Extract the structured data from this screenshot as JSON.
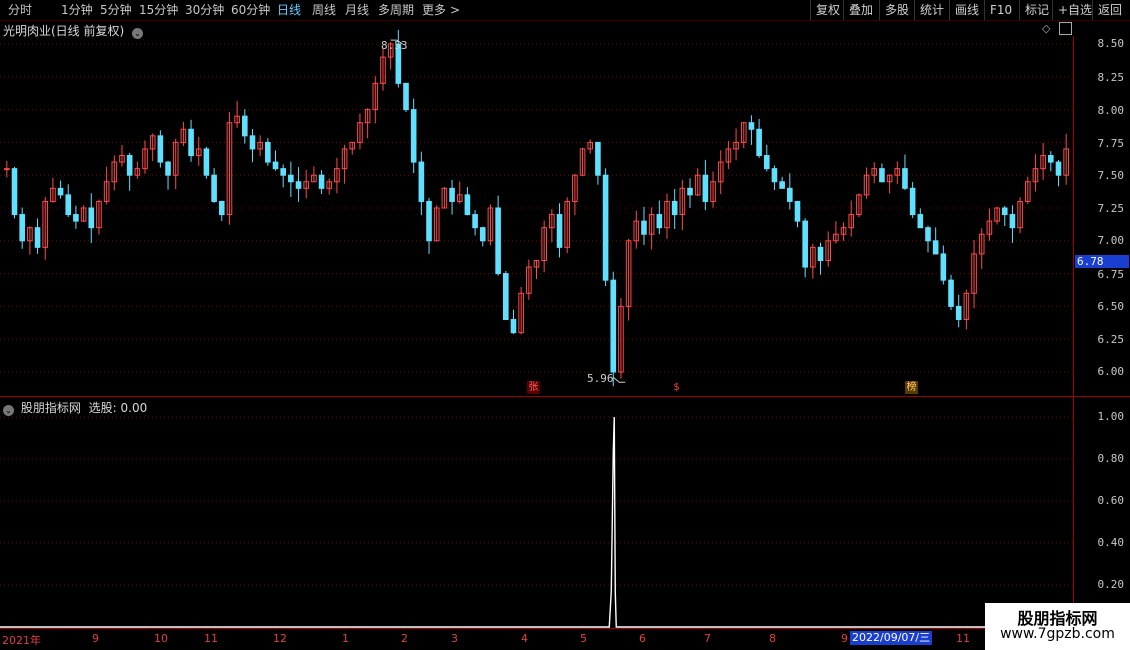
{
  "toolbar": {
    "periods": [
      "分时",
      "1分钟",
      "5分钟",
      "15分钟",
      "30分钟",
      "60分钟",
      "日线",
      "周线",
      "月线",
      "多周期",
      "更多"
    ],
    "active_period": "日线",
    "more_arrow": ">",
    "actions": [
      "复权",
      "叠加",
      "多股",
      "统计",
      "画线",
      "F10",
      "标记",
      "+自选",
      "返回"
    ]
  },
  "main_panel": {
    "title": "光明肉业(日线 前复权)",
    "y_ticks": [
      "8.50",
      "8.25",
      "8.00",
      "7.75",
      "7.50",
      "7.25",
      "7.00",
      "6.75",
      "6.50",
      "6.25",
      "6.00"
    ],
    "current_price": "6.78",
    "high_label": "8.53",
    "low_label": "5.96",
    "badges": [
      {
        "text": "张",
        "color": "#ff6060",
        "bg": "#5a0000"
      },
      {
        "text": "$",
        "color": "#ff4040",
        "bg": "#000000"
      },
      {
        "text": "榜",
        "color": "#ffcc66",
        "bg": "#5a3a00"
      }
    ]
  },
  "indicator_panel": {
    "title": "股朋指标网",
    "signal_label": "选股: 0.00",
    "y_ticks": [
      "1.00",
      "0.80",
      "0.60",
      "0.40",
      "0.20"
    ]
  },
  "x_axis": {
    "labels": [
      "2021年",
      "9",
      "10",
      "11",
      "12",
      "1",
      "2",
      "3",
      "4",
      "5",
      "6",
      "7",
      "8",
      "9",
      "11"
    ],
    "cursor_date": "2022/09/07/三"
  },
  "watermark": {
    "line1": "股朋指标网",
    "line2": "www.7gpzb.com"
  },
  "colors": {
    "up": "#ff4a4a",
    "down": "#5fe0ff",
    "grid": "#7a0000",
    "accent": "#1a3fd0"
  },
  "chart_data": {
    "type": "candlestick",
    "price_range": [
      5.96,
      8.53
    ],
    "ylim": [
      5.9,
      8.6
    ],
    "closes": [
      7.55,
      7.2,
      7.0,
      7.1,
      6.95,
      7.3,
      7.4,
      7.35,
      7.2,
      7.15,
      7.25,
      7.1,
      7.3,
      7.45,
      7.6,
      7.65,
      7.5,
      7.55,
      7.7,
      7.8,
      7.6,
      7.5,
      7.75,
      7.85,
      7.65,
      7.7,
      7.5,
      7.3,
      7.2,
      7.9,
      7.95,
      7.8,
      7.7,
      7.75,
      7.6,
      7.55,
      7.5,
      7.45,
      7.4,
      7.45,
      7.5,
      7.4,
      7.45,
      7.55,
      7.7,
      7.75,
      7.9,
      8.0,
      8.2,
      8.4,
      8.5,
      8.2,
      8.0,
      7.6,
      7.3,
      7.0,
      7.25,
      7.4,
      7.3,
      7.35,
      7.2,
      7.1,
      7.0,
      7.25,
      6.75,
      6.4,
      6.3,
      6.6,
      6.8,
      6.85,
      7.1,
      7.2,
      6.95,
      7.3,
      7.5,
      7.7,
      7.75,
      7.5,
      6.7,
      6.0,
      6.5,
      7.0,
      7.15,
      7.05,
      7.2,
      7.1,
      7.3,
      7.2,
      7.4,
      7.35,
      7.5,
      7.3,
      7.45,
      7.6,
      7.7,
      7.75,
      7.9,
      7.85,
      7.65,
      7.55,
      7.45,
      7.4,
      7.3,
      7.15,
      6.8,
      6.95,
      6.85,
      7.0,
      7.05,
      7.1,
      7.2,
      7.35,
      7.5,
      7.55,
      7.45,
      7.5,
      7.55,
      7.4,
      7.2,
      7.1,
      7.0,
      6.9,
      6.7,
      6.5,
      6.4,
      6.6,
      6.9,
      7.05,
      7.15,
      7.25,
      7.2,
      7.1,
      7.3,
      7.45,
      7.55,
      7.65,
      7.6,
      7.5,
      7.7
    ],
    "signal_series": {
      "name": "选股",
      "peak_index": 79,
      "peak_value": 1.0,
      "baseline": 0.0
    }
  }
}
